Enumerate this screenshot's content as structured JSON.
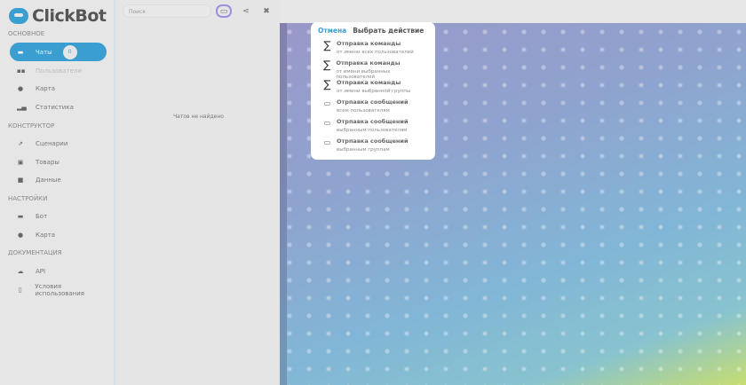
{
  "app": {
    "name": "ClickBot"
  },
  "sidebar": {
    "sections": [
      {
        "title": "Основное",
        "items": [
          {
            "label": "Чаты",
            "badge": "0",
            "icon": "chat-icon"
          },
          {
            "label": "Пользователи",
            "icon": "users-icon"
          },
          {
            "label": "Карта",
            "icon": "map-pin-icon"
          },
          {
            "label": "Статистика",
            "icon": "chart-icon"
          }
        ]
      },
      {
        "title": "Конструктор",
        "items": [
          {
            "label": "Сценарии",
            "icon": "scenario-icon"
          },
          {
            "label": "Товары",
            "icon": "goods-icon"
          },
          {
            "label": "Данные",
            "icon": "database-icon"
          }
        ]
      },
      {
        "title": "Настройки",
        "items": [
          {
            "label": "Бот",
            "icon": "bot-icon"
          },
          {
            "label": "Карта",
            "icon": "map-pin-icon"
          }
        ]
      },
      {
        "title": "Документация",
        "items": [
          {
            "label": "API",
            "icon": "cloud-icon"
          },
          {
            "label": "Условия использования",
            "icon": "document-icon"
          }
        ]
      }
    ]
  },
  "chats": {
    "search_placeholder": "Поиск",
    "empty": "Чатов не найдено"
  },
  "dialog": {
    "cancel": "Отмена",
    "title": "Выбрать действие",
    "actions": [
      {
        "title": "Отправка команды",
        "subtitle": "от имени всех пользователей",
        "icon": "sigma-icon"
      },
      {
        "title": "Отправка команды",
        "subtitle": "от имени выбранных пользователей",
        "icon": "sigma-icon"
      },
      {
        "title": "Отправка команды",
        "subtitle": "от имени выбранной группы",
        "icon": "sigma-icon"
      },
      {
        "title": "Отрпавка сообщений",
        "subtitle": "всем пользователям",
        "icon": "message-icon"
      },
      {
        "title": "Отрпавка сообщений",
        "subtitle": "выбранным пользователям",
        "icon": "message-icon"
      },
      {
        "title": "Отрпавка сообщений",
        "subtitle": "выбранным группам",
        "icon": "message-icon"
      }
    ]
  },
  "colors": {
    "accent": "#3a9fd0"
  }
}
